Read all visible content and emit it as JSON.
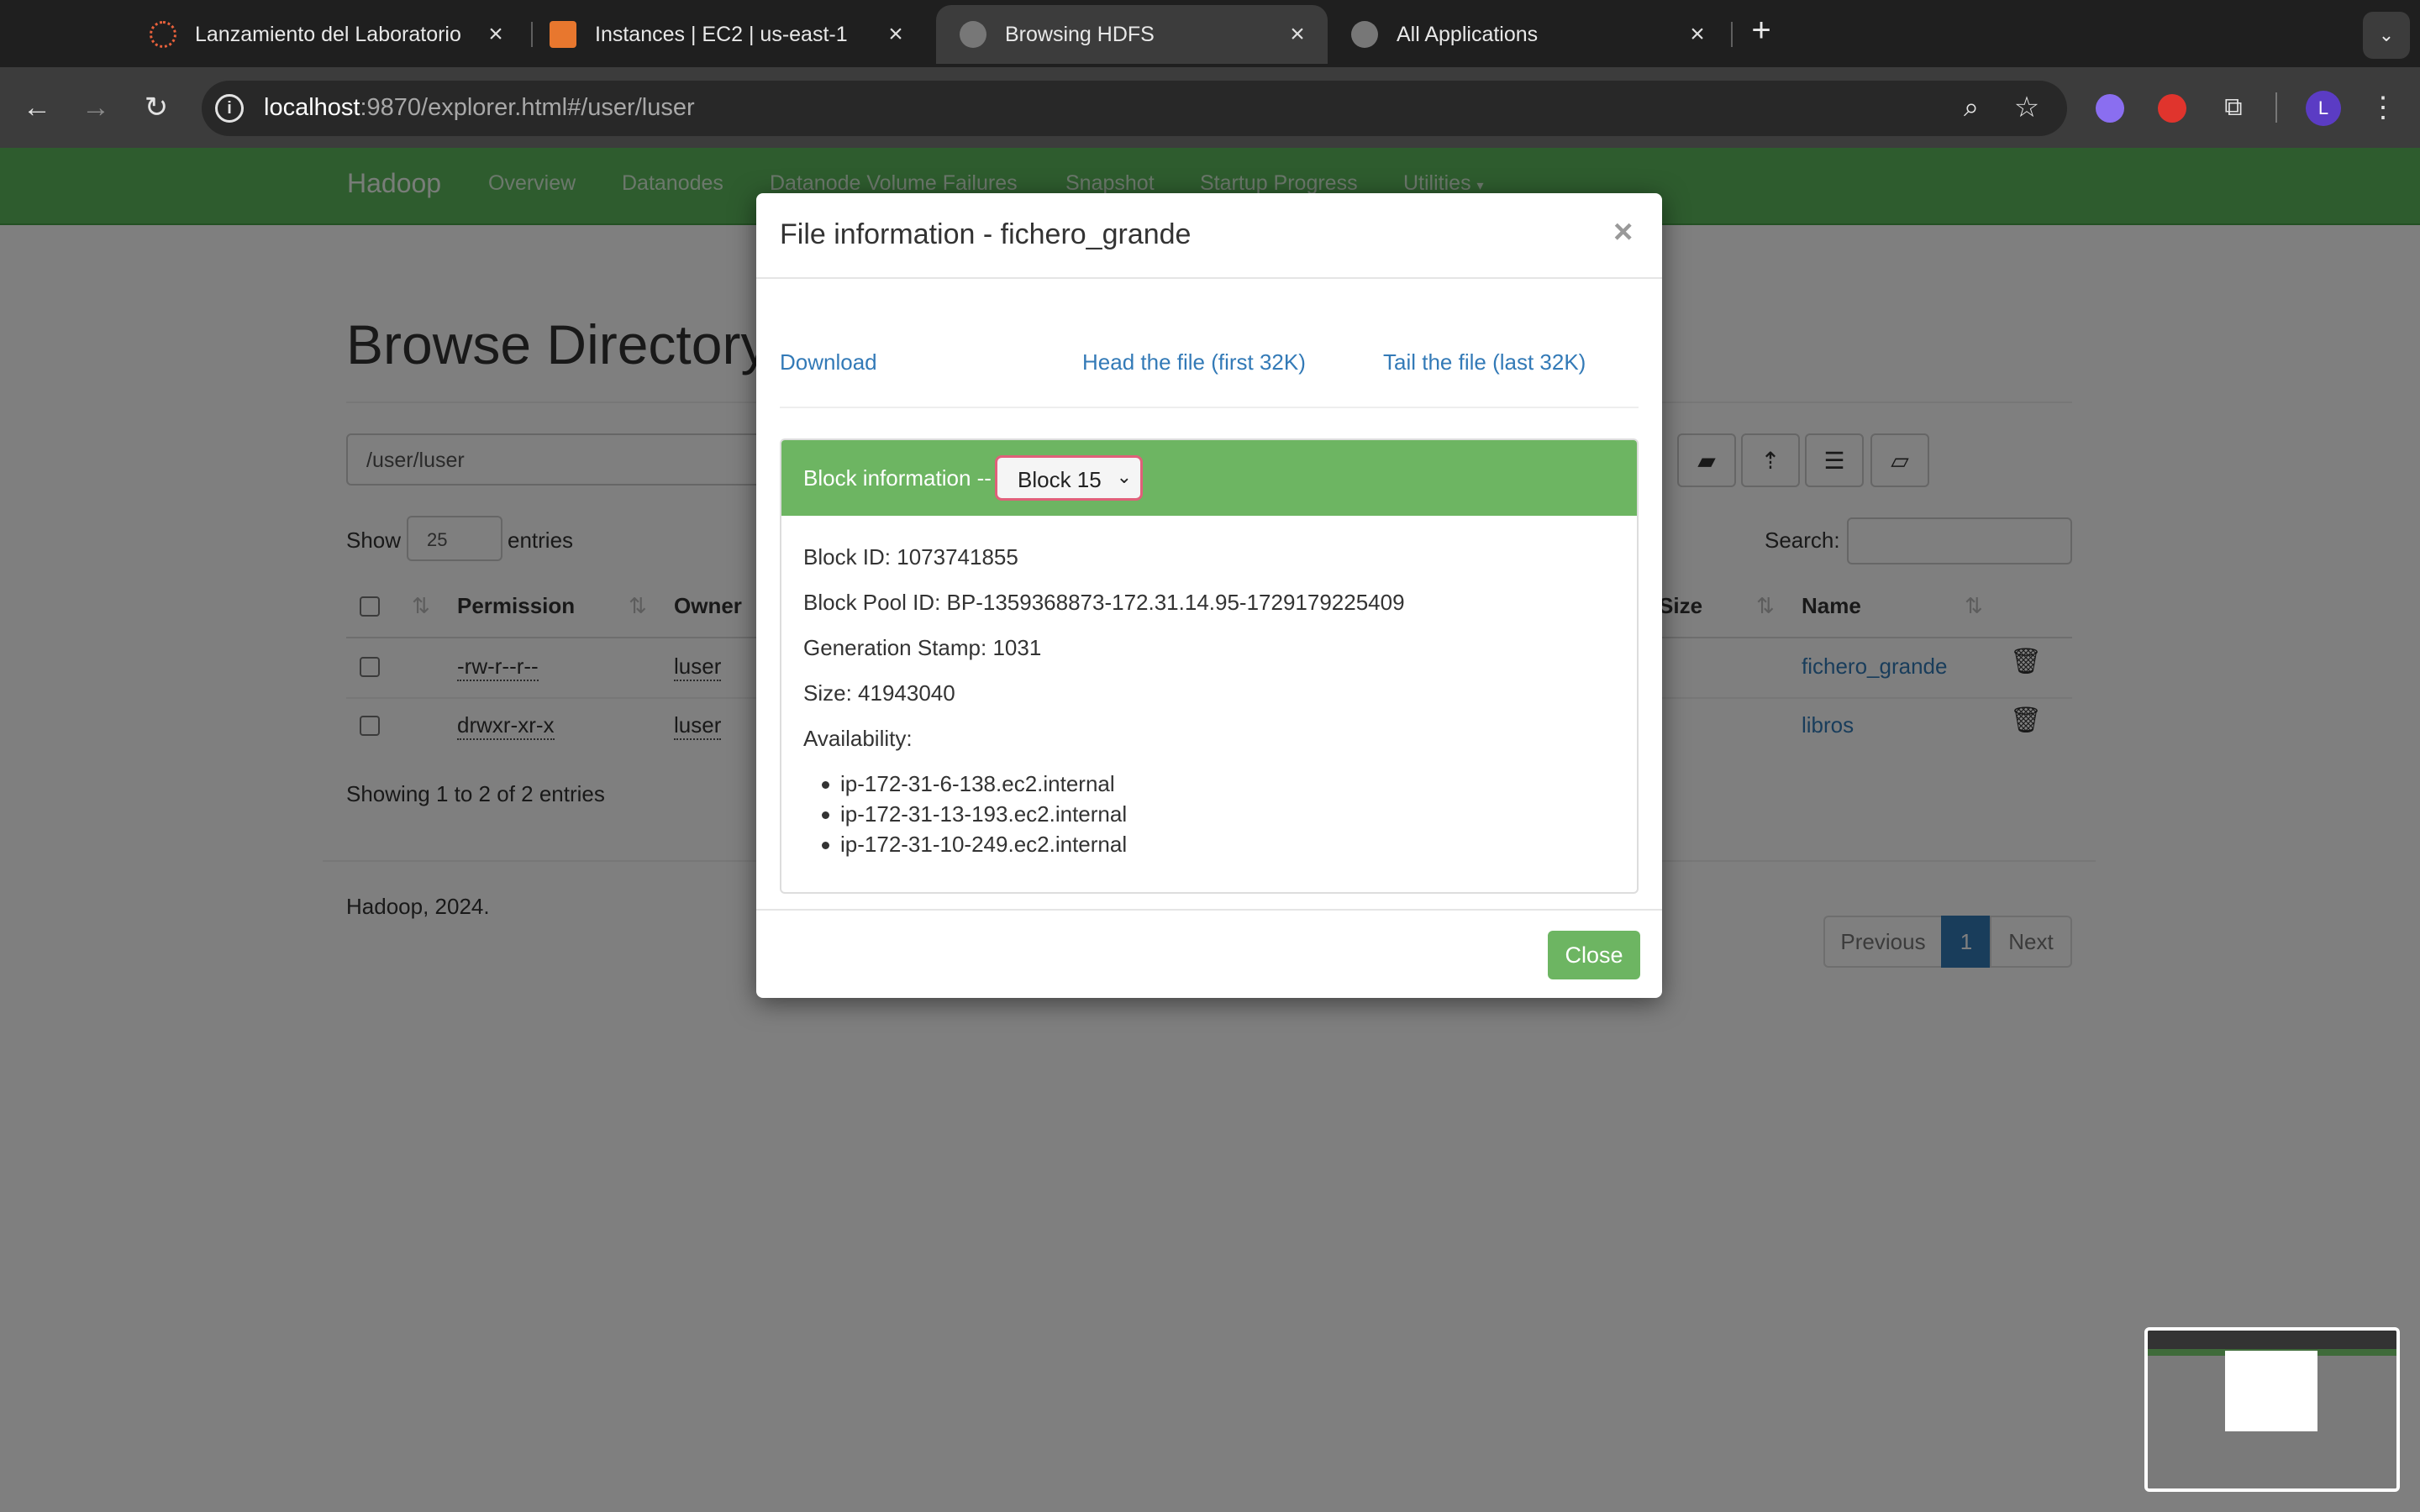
{
  "tabs": [
    {
      "title": "Lanzamiento del Laboratorio",
      "icon": "aws-academy-icon"
    },
    {
      "title": "Instances | EC2 | us-east-1",
      "icon": "ec2-icon"
    },
    {
      "title": "Browsing HDFS",
      "icon": "globe-icon"
    },
    {
      "title": "All Applications",
      "icon": "globe-icon"
    }
  ],
  "address": {
    "host": "localhost",
    "rest": ":9870/explorer.html#/user/luser"
  },
  "profile_initial": "L",
  "navbar": {
    "brand": "Hadoop",
    "items": [
      "Overview",
      "Datanodes",
      "Datanode Volume Failures",
      "Snapshot",
      "Startup Progress",
      "Utilities"
    ]
  },
  "browse": {
    "heading": "Browse Directory",
    "path": "/user/luser",
    "show_label": "Show",
    "entries_count": "25",
    "entries_label": "entries",
    "search_label": "Search:",
    "columns": {
      "permission": "Permission",
      "owner": "Owner",
      "size": "Size",
      "name": "Name"
    },
    "rows": [
      {
        "permission": "-rw-r--r--",
        "owner": "luser",
        "name": "fichero_grande"
      },
      {
        "permission": "drwxr-xr-x",
        "owner": "luser",
        "name": "libros"
      }
    ],
    "summary": "Showing 1 to 2 of 2 entries",
    "pager": {
      "previous": "Previous",
      "page": "1",
      "next": "Next"
    },
    "footer": "Hadoop, 2024."
  },
  "modal": {
    "title": "File information - fichero_grande",
    "close_x": "×",
    "links": {
      "download": "Download",
      "head": "Head the file (first 32K)",
      "tail": "Tail the file (last 32K)"
    },
    "block_label": "Block information --",
    "block_selected": "Block 15",
    "block_id": "Block ID: 1073741855",
    "pool_id": "Block Pool ID: BP-1359368873-172.31.14.95-1729179225409",
    "gen_stamp": "Generation Stamp: 1031",
    "size": "Size: 41943040",
    "availability_label": "Availability:",
    "hosts": [
      "ip-172-31-6-138.ec2.internal",
      "ip-172-31-13-193.ec2.internal",
      "ip-172-31-10-249.ec2.internal"
    ],
    "close_button": "Close"
  },
  "colors": {
    "navbar_green": "#5cb85c",
    "panel_green": "#6db562",
    "link_blue": "#337ab7",
    "active_page": "#337ab7"
  }
}
